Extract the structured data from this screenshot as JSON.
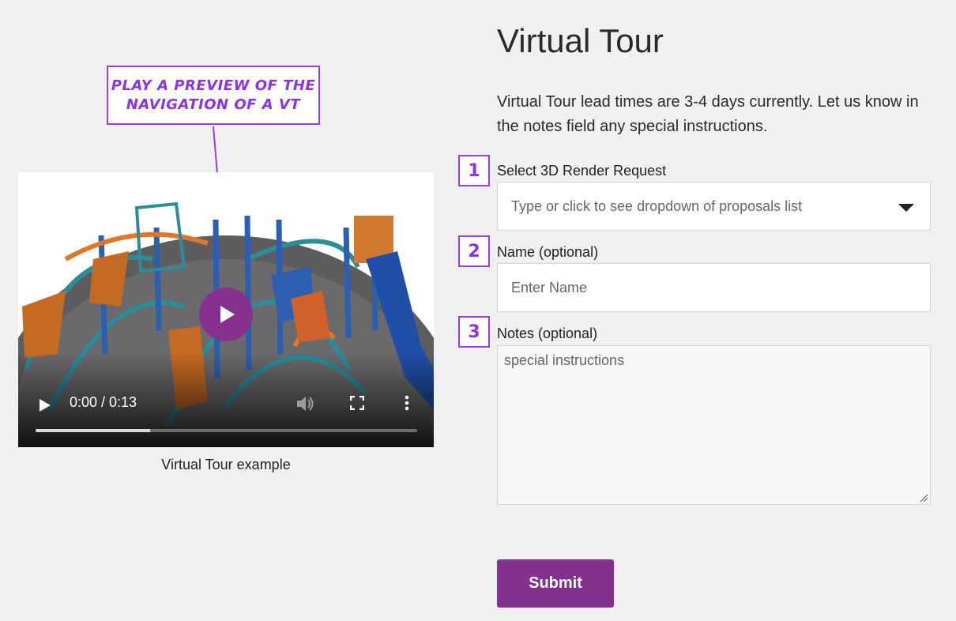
{
  "callout": {
    "text": "Play a preview of the navigation of a VT"
  },
  "video": {
    "time": "0:00 / 0:13",
    "progress": 0.3,
    "caption": "Virtual Tour example"
  },
  "form": {
    "title": "Virtual Tour",
    "intro": "Virtual Tour lead times are 3-4 days currently. Let us know in the notes field any special instructions.",
    "steps": [
      "1",
      "2",
      "3"
    ],
    "render_label": "Select 3D Render Request",
    "render_placeholder": "Type or click to see dropdown of proposals list",
    "name_label": "Name (optional)",
    "name_placeholder": "Enter Name",
    "notes_label": "Notes (optional)",
    "notes_placeholder": "special instructions",
    "submit_label": "Submit"
  },
  "colors": {
    "accent": "#86318f",
    "annotation": "#8d33e6",
    "background": "#f0f0f0"
  }
}
